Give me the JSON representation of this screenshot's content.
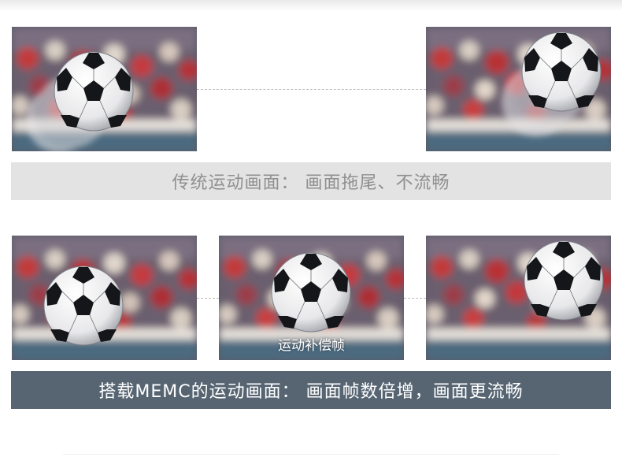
{
  "section1": {
    "banner_text": "传统运动画面： 画面拖尾、不流畅"
  },
  "section2": {
    "middle_caption": "运动补偿帧",
    "banner_text": "搭载MEMC的运动画面： 画面帧数倍增，画面更流畅"
  },
  "icons": {
    "ball": "soccer-ball-icon"
  },
  "colors": {
    "light_banner_bg": "#e3e3e3",
    "light_banner_text": "#8f8f8f",
    "dark_banner_bg": "#576573",
    "dark_banner_text": "#ffffff"
  }
}
